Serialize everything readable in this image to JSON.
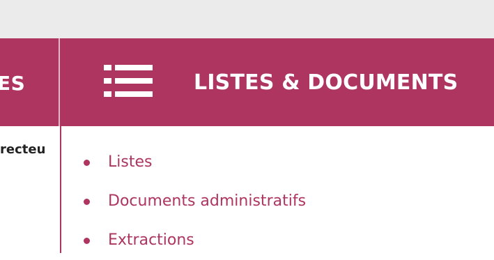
{
  "topbar": {},
  "nav": {
    "left_item_label": "ES",
    "main_item": {
      "label": "LISTES & DOCUMENTS",
      "icon": "list-icon"
    }
  },
  "left_panel": {
    "fragment_text": "recteu"
  },
  "dropdown": {
    "items": [
      {
        "label": "Listes"
      },
      {
        "label": "Documents administratifs"
      },
      {
        "label": "Extractions"
      }
    ]
  },
  "colors": {
    "accent": "#ad3560",
    "topbar": "#ebebeb",
    "divider": "#e6b7c8",
    "text_dark": "#222222"
  }
}
